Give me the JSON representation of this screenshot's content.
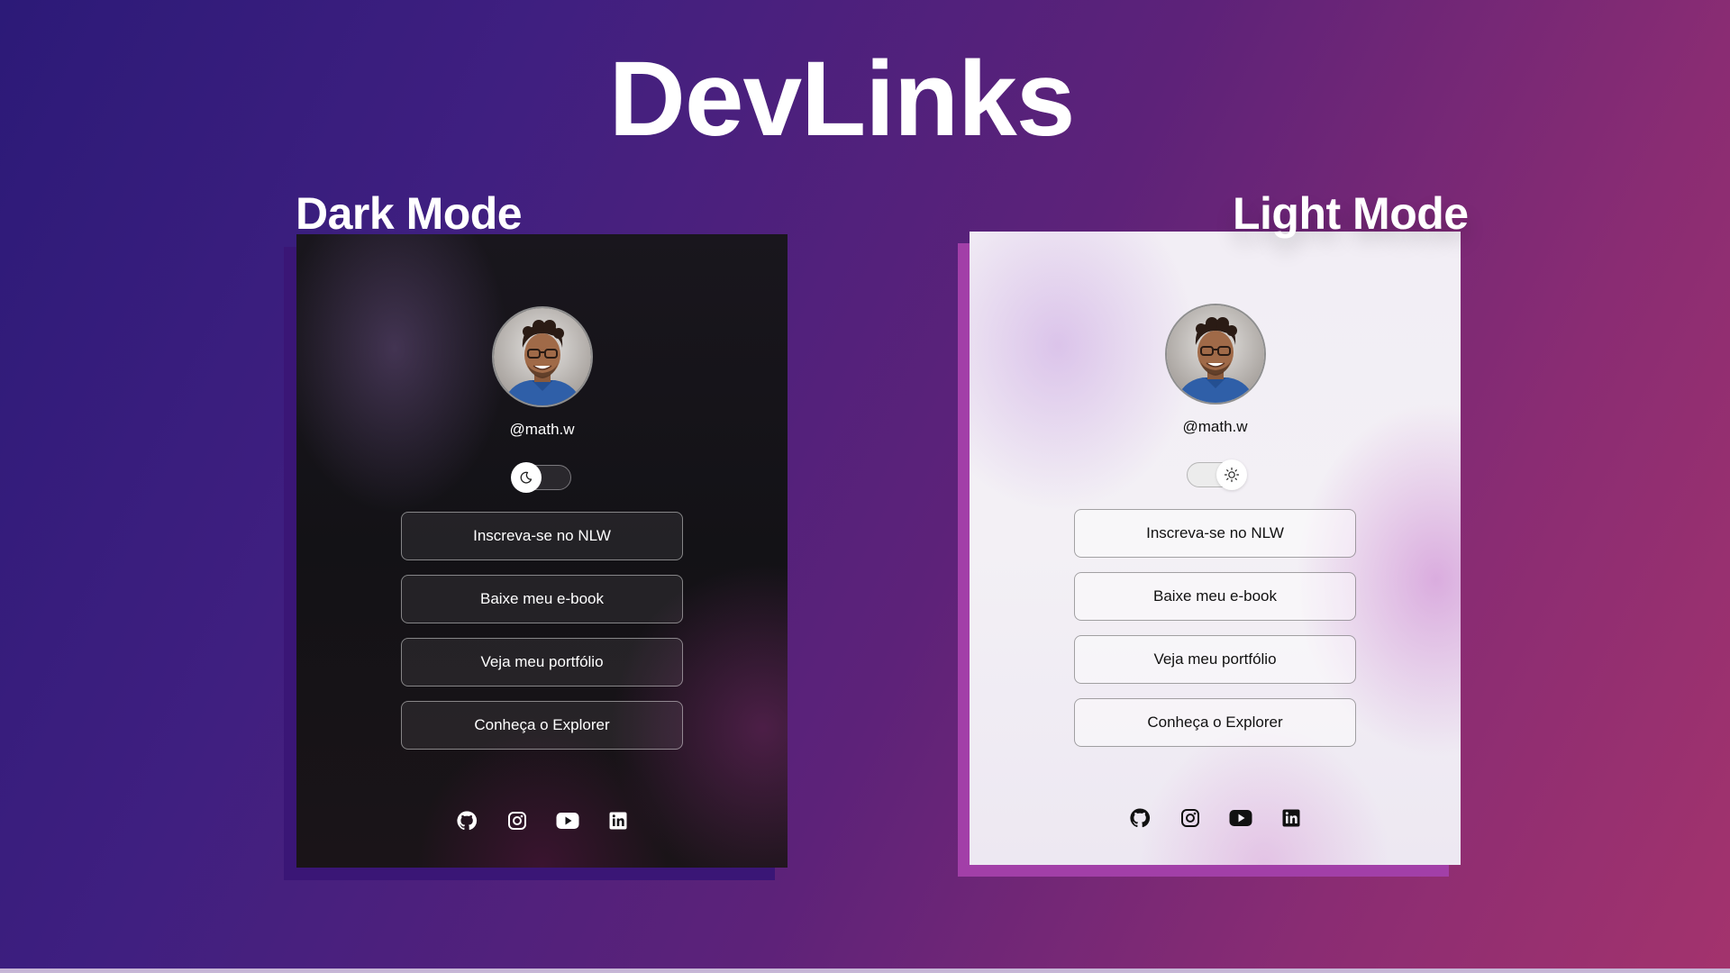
{
  "page": {
    "title": "DevLinks",
    "dark_mode_label": "Dark Mode",
    "light_mode_label": "Light Mode"
  },
  "dark_panel": {
    "handle": "@math.w",
    "theme_toggle": {
      "state": "dark",
      "knob_icon": "moon-icon"
    },
    "links": [
      "Inscreva-se no NLW",
      "Baixe meu e-book",
      "Veja meu portfólio",
      "Conheça o Explorer"
    ],
    "socials": [
      "github-icon",
      "instagram-icon",
      "youtube-icon",
      "linkedin-icon"
    ]
  },
  "light_panel": {
    "handle": "@math.w",
    "theme_toggle": {
      "state": "light",
      "knob_icon": "sun-icon"
    },
    "links": [
      "Inscreva-se no NLW",
      "Baixe meu e-book",
      "Veja meu portfólio",
      "Conheça o Explorer"
    ],
    "socials": [
      "github-icon",
      "instagram-icon",
      "youtube-icon",
      "linkedin-icon"
    ]
  },
  "colors": {
    "background_start": "#2c1a78",
    "background_end": "#a3336d",
    "dark_panel_bg": "#131216",
    "light_panel_bg": "#f2eef5",
    "dark_shadow": "#3a1676",
    "light_shadow": "#a23fa8"
  }
}
